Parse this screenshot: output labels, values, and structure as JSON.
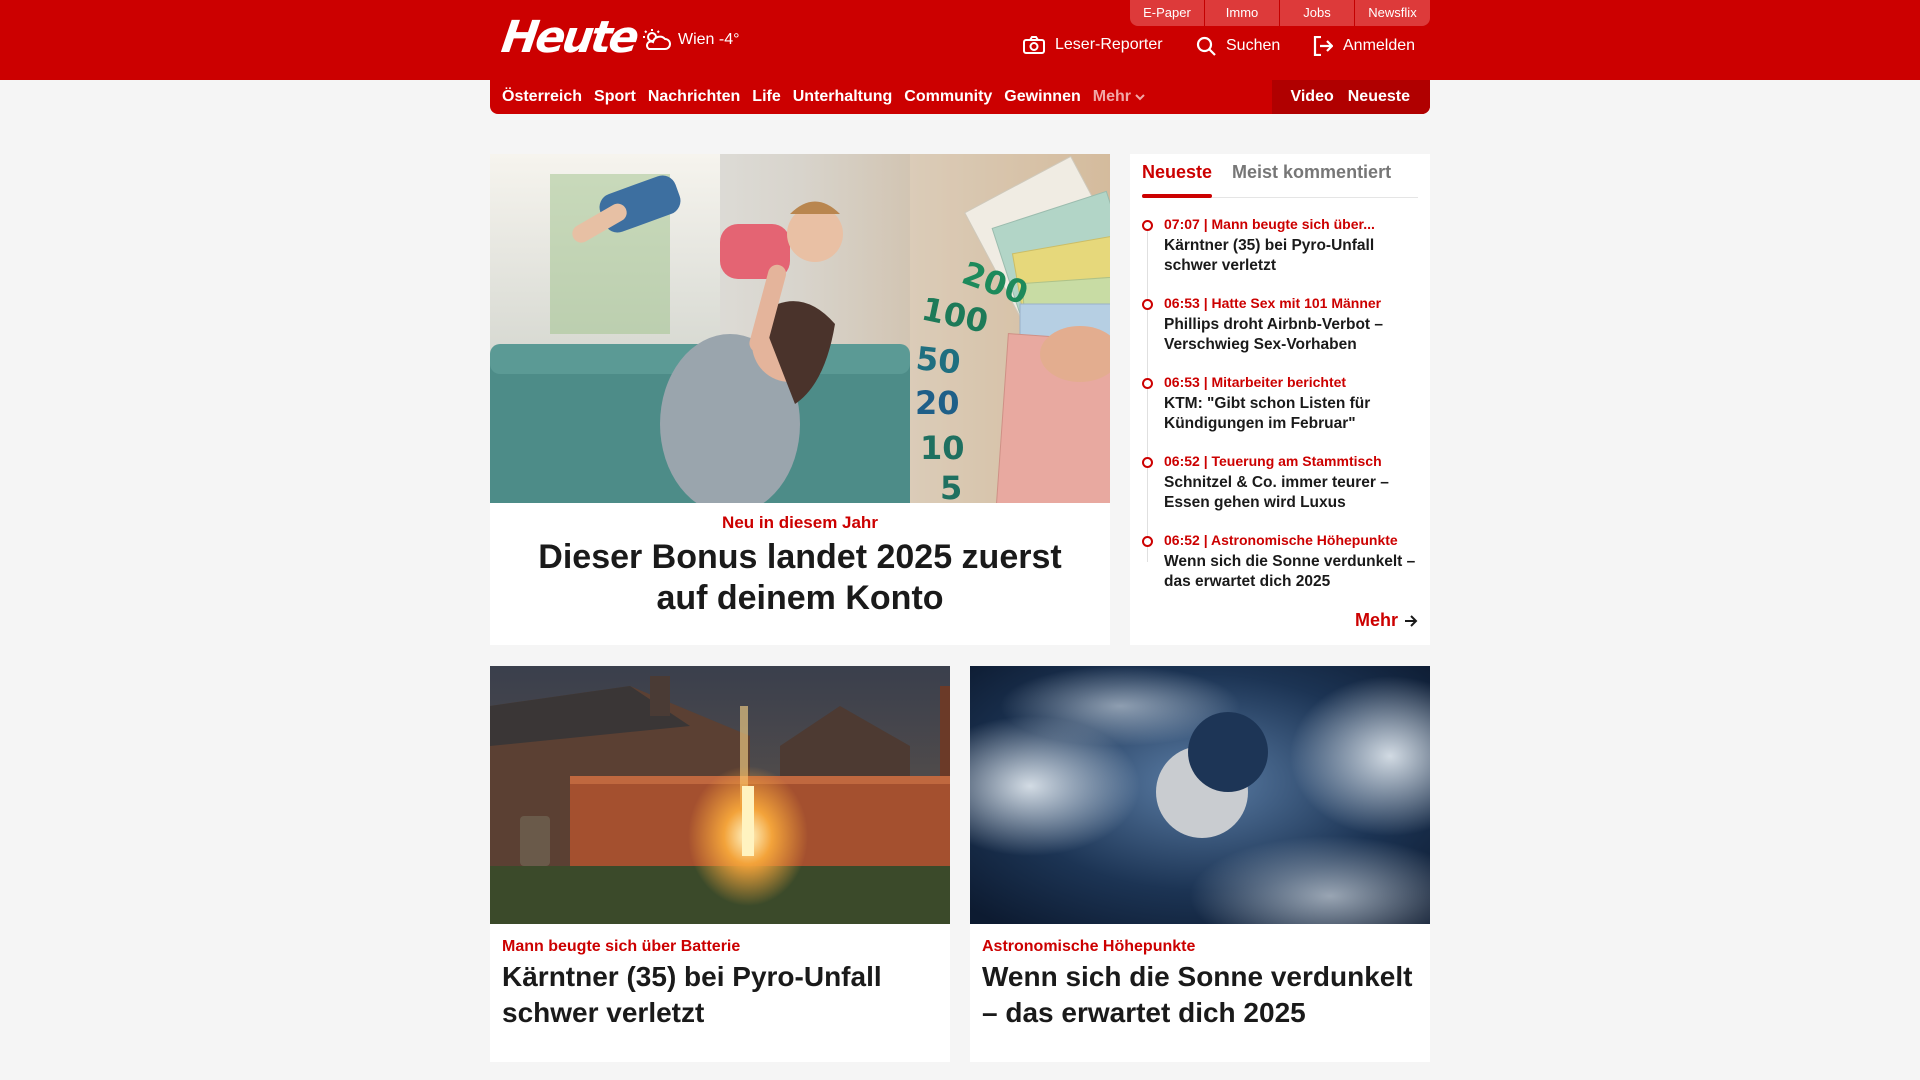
{
  "header": {
    "logo": "Heute",
    "weather": "Wien -4°",
    "top_links": [
      "E-Paper",
      "Immo",
      "Jobs",
      "Newsflix"
    ],
    "leser_reporter": "Leser-Reporter",
    "search": "Suchen",
    "login": "Anmelden"
  },
  "nav": {
    "items": [
      "Österreich",
      "Sport",
      "Nachrichten",
      "Life",
      "Unterhaltung",
      "Community",
      "Gewinnen"
    ],
    "more": "Mehr",
    "video": "Video",
    "newest": "Neueste"
  },
  "hero": {
    "kicker": "Neu in diesem Jahr",
    "title": "Dieser Bonus landet 2025 zuerst auf deinem Konto",
    "banknote_values": [
      "200",
      "100",
      "50",
      "20",
      "10",
      "5"
    ]
  },
  "sidebar": {
    "tabs": [
      "Neueste",
      "Meist kommentiert"
    ],
    "items": [
      {
        "meta": "07:07 | Mann beugte sich über...",
        "headline": "Kärntner (35) bei Pyro-Unfall schwer verletzt"
      },
      {
        "meta": "06:53 | Hatte Sex mit 101 Männer",
        "headline": "Phillips droht Airbnb-Verbot – Verschwieg Sex-Vorhaben"
      },
      {
        "meta": "06:53 | Mitarbeiter berichtet",
        "headline": "KTM: \"Gibt schon Listen für Kündigungen im Februar\""
      },
      {
        "meta": "06:52 | Teuerung am Stammtisch",
        "headline": "Schnitzel & Co. immer teurer – Essen gehen wird Luxus"
      },
      {
        "meta": "06:52 | Astronomische Höhepunkte",
        "headline": "Wenn sich die Sonne verdunkelt – das erwartet dich 2025"
      }
    ],
    "more": "Mehr"
  },
  "cards": [
    {
      "kicker": "Mann beugte sich über Batterie",
      "title": "Kärntner (35) bei Pyro-Unfall schwer verletzt"
    },
    {
      "kicker": "Astronomische Höhepunkte",
      "title": "Wenn sich die Sonne verdunkelt – das erwartet dich 2025"
    }
  ],
  "colors": {
    "brand": "#cc0000",
    "background": "#f5f5f5"
  }
}
